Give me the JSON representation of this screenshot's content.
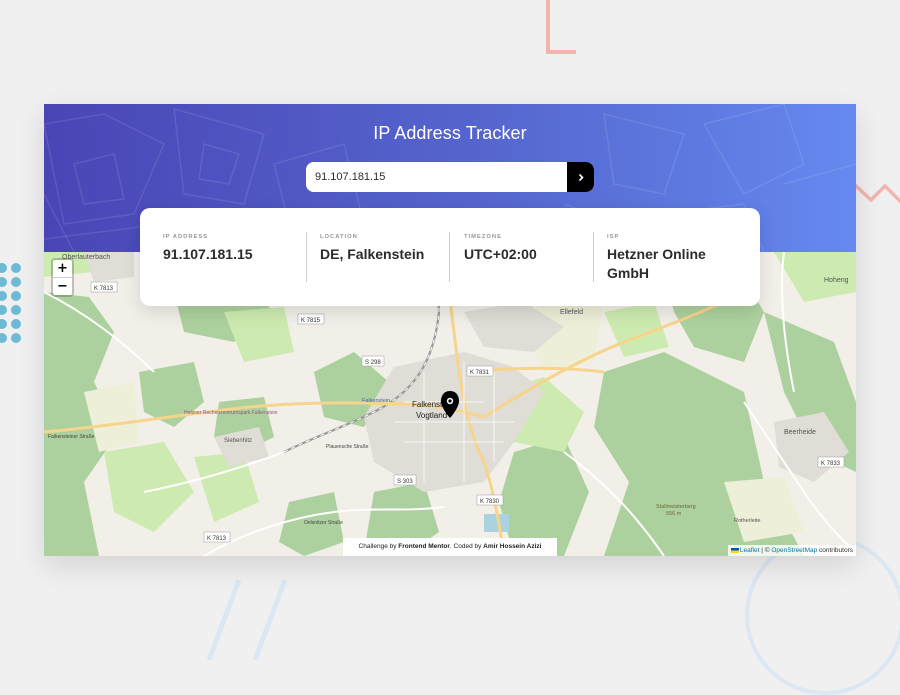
{
  "app": {
    "title": "IP Address Tracker"
  },
  "search": {
    "value": "91.107.181.15",
    "submit_icon": "chevron-right-icon"
  },
  "info": {
    "ip_label": "IP ADDRESS",
    "ip_value": "91.107.181.15",
    "location_label": "LOCATION",
    "location_value": "DE, Falkenstein",
    "timezone_label": "TIMEZONE",
    "timezone_value": "UTC+02:00",
    "isp_label": "ISP",
    "isp_value": "Hetzner Online GmbH"
  },
  "map": {
    "zoom_in": "+",
    "zoom_out": "−",
    "marker_icon": "location-pin-icon",
    "labels": {
      "oberlauterbach": "Oberlauterbach",
      "k7813_top": "K 7813",
      "k7815": "K 7815",
      "s298": "S 298",
      "k7831": "K 7831",
      "ellefeld": "Ellefeld",
      "falkenstein": "Falkenstein",
      "vogtland": "Vogtland",
      "falkenstein_station": "Falkenstein",
      "siebenhitz": "Siebenhitz",
      "plauensche": "Plauensche Straße",
      "hetzner_dc": "Hetzner Rechenzentrumspark Falkenstein",
      "s303": "S 303",
      "k7830": "K 7830",
      "k7813_bottom": "K 7813",
      "beerheide": "Beerheide",
      "k7833": "K 7833",
      "hoheng": "Hoheng",
      "stallmeisterberg": "Stallmeisterberg",
      "stallmeisterberg_height": "556 m",
      "rotherleiten": "Rotherleite",
      "falkensteiner_strasse": "Falkensteiner Straße",
      "oelsnitzer": "Oelsnitzer Straße"
    },
    "attribution": {
      "leaflet": "Leaflet",
      "separator": " | © ",
      "osm": "OpenStreetMap",
      "contributors": " contributors"
    },
    "credit": {
      "prefix": "Challenge by ",
      "mentor": "Frontend Mentor",
      "middle": ". Coded by ",
      "author": "Amir Hossein Azizi"
    }
  },
  "colors": {
    "header_start": "#4a45b6",
    "header_end": "#6589f0",
    "forest": "#add19e",
    "meadow": "#cdebb0",
    "urban": "#e0dcd6"
  }
}
